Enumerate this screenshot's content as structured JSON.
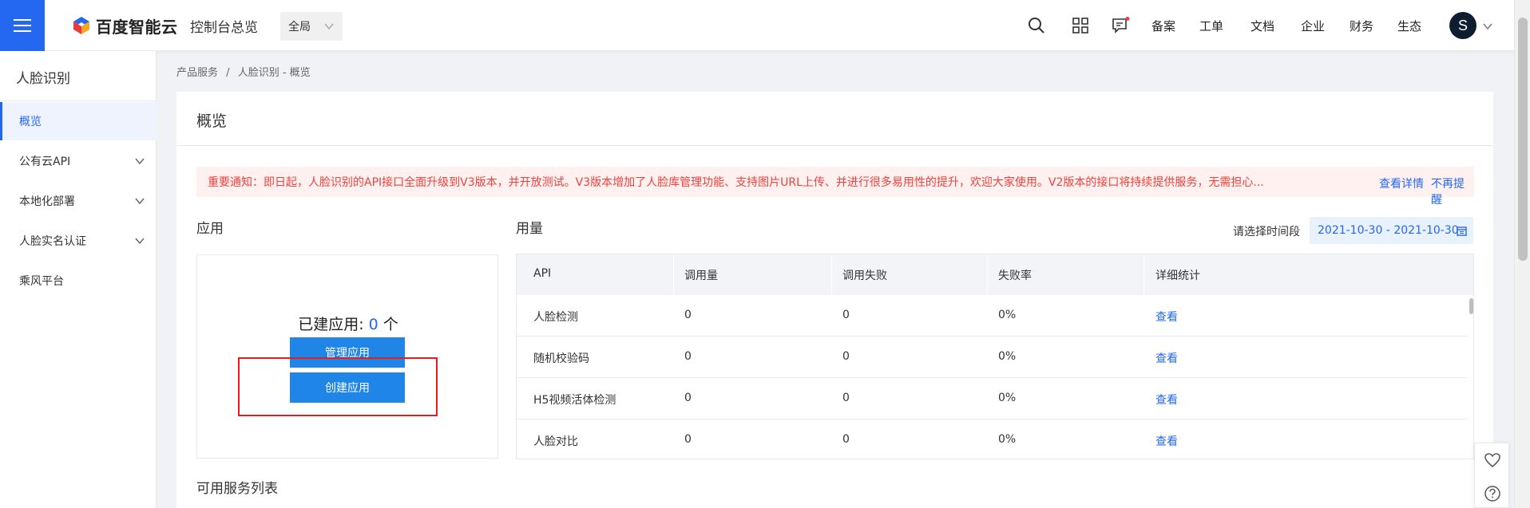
{
  "header": {
    "logo_text": "百度智能云",
    "console_title": "控制台总览",
    "region_select": "全局",
    "nav_links": [
      "备案",
      "工单",
      "文档",
      "企业",
      "财务",
      "生态"
    ],
    "avatar_letter": "S",
    "accent_color": "#2468f2"
  },
  "sidebar": {
    "title": "人脸识别",
    "items": [
      {
        "label": "概览",
        "active": true
      },
      {
        "label": "公有云API",
        "expandable": true
      },
      {
        "label": "本地化部署",
        "expandable": true
      },
      {
        "label": "人脸实名认证",
        "expandable": true
      },
      {
        "label": "乘风平台"
      }
    ]
  },
  "breadcrumb": {
    "items": [
      "产品服务",
      "/",
      "人脸识别 - 概览"
    ]
  },
  "main": {
    "title": "概览",
    "notice": {
      "text": "重要通知：即日起，人脸识别的API接口全面升级到V3版本，并开放测试。V3版本增加了人脸库管理功能、支持图片URL上传、并进行很多易用性的提升，欢迎大家使用。V2版本的接口将持续提供服务，无需担心...",
      "link_details": "查看详情",
      "link_dismiss": "不再提醒"
    },
    "apps": {
      "section_label": "应用",
      "count_prefix": "已建应用: ",
      "count": "0",
      "count_suffix": " 个",
      "manage_button": "管理应用",
      "create_button": "创建应用"
    },
    "usage": {
      "section_label": "用量",
      "date_label": "请选择时间段",
      "date_range": "2021-10-30 - 2021-10-30",
      "columns": [
        "API",
        "调用量",
        "调用失败",
        "失败率",
        "详细统计"
      ],
      "rows": [
        {
          "api": "人脸检测",
          "calls": "0",
          "failures": "0",
          "rate": "0%",
          "action": "查看"
        },
        {
          "api": "随机校验码",
          "calls": "0",
          "failures": "0",
          "rate": "0%",
          "action": "查看"
        },
        {
          "api": "H5视频活体检测",
          "calls": "0",
          "failures": "0",
          "rate": "0%",
          "action": "查看"
        },
        {
          "api": "人脸对比",
          "calls": "0",
          "failures": "0",
          "rate": "0%",
          "action": "查看"
        }
      ]
    },
    "services": {
      "section_label": "可用服务列表"
    }
  },
  "floating": {
    "icons": [
      "heart-icon",
      "help-icon"
    ]
  }
}
